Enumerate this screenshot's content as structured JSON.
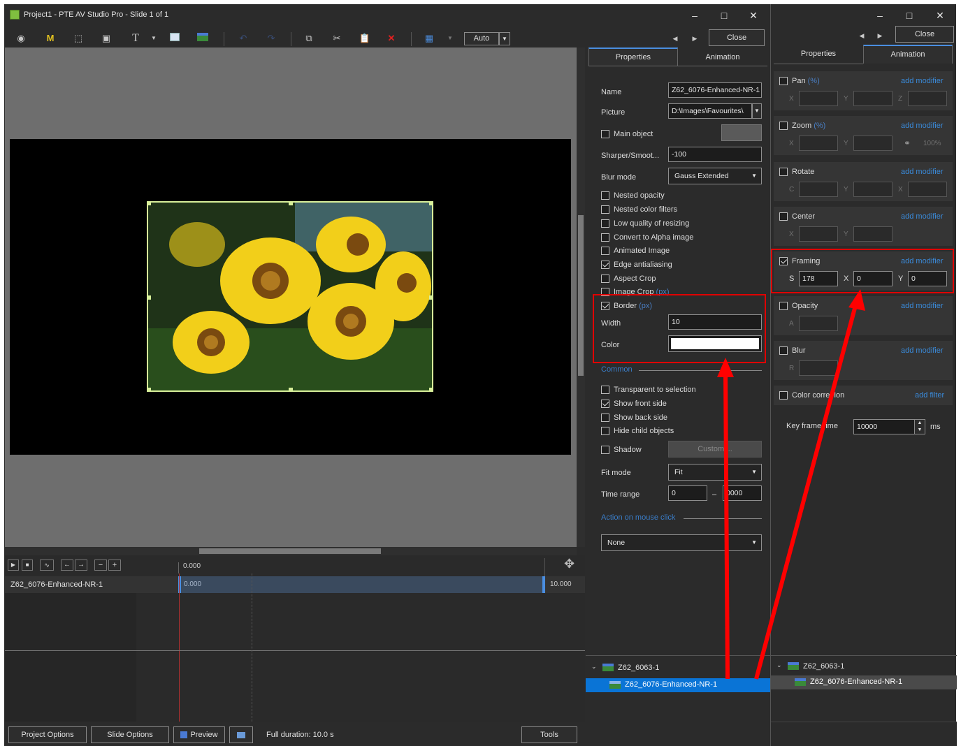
{
  "window": {
    "title": "Project1 - PTE AV Studio Pro - Slide 1 of 1",
    "minimize": "–",
    "maximize": "□",
    "close": "✕"
  },
  "toolbar": {
    "auto_label": "Auto",
    "close_label": "Close"
  },
  "properties_tabs": [
    "Properties",
    "Animation"
  ],
  "properties": {
    "name_label": "Name",
    "name_value": "Z62_6076-Enhanced-NR-1",
    "picture_label": "Picture",
    "picture_value": "D:\\Images\\Favourites\\",
    "main_object_label": "Main object",
    "sharper_label": "Sharper/Smoot...",
    "sharper_value": "-100",
    "blur_mode_label": "Blur mode",
    "blur_mode_value": "Gauss Extended",
    "checkboxes": [
      {
        "label": "Nested opacity",
        "checked": false
      },
      {
        "label": "Nested color filters",
        "checked": false
      },
      {
        "label": "Low quality of resizing",
        "checked": false
      },
      {
        "label": "Convert to Alpha image",
        "checked": false
      },
      {
        "label": "Animated Image",
        "checked": false
      },
      {
        "label": "Edge antialiasing",
        "checked": true
      },
      {
        "label": "Aspect Crop",
        "checked": false
      },
      {
        "label": "Image Crop",
        "unit": "(px)",
        "checked": false
      },
      {
        "label": "Border",
        "unit": "(px)",
        "checked": true
      }
    ],
    "width_label": "Width",
    "width_value": "10",
    "color_label": "Color",
    "border_color": "#ffffff",
    "common_label": "Common",
    "common_checkboxes": [
      {
        "label": "Transparent to selection",
        "checked": false
      },
      {
        "label": "Show front side",
        "checked": true
      },
      {
        "label": "Show back side",
        "checked": false
      },
      {
        "label": "Hide child objects",
        "checked": false
      }
    ],
    "shadow_label": "Shadow",
    "customize_label": "Customi...",
    "fit_mode_label": "Fit mode",
    "fit_mode_value": "Fit",
    "time_range_label": "Time range",
    "time_range_from": "0",
    "time_range_dash": "–",
    "time_range_to": "0000",
    "action_label": "Action on mouse click",
    "action_value": "None"
  },
  "objects_tree": {
    "parent": "Z62_6063-1",
    "child": "Z62_6076-Enhanced-NR-1"
  },
  "animation": {
    "add_modifier": "add modifier",
    "add_filter": "add filter",
    "pan": {
      "label": "Pan",
      "unit": "(%)",
      "x": "X",
      "y": "Y",
      "z": "Z"
    },
    "zoom": {
      "label": "Zoom",
      "unit": "(%)",
      "x": "X",
      "y": "Y",
      "pct": "100%"
    },
    "rotate": {
      "label": "Rotate",
      "c": "C",
      "y": "Y",
      "x": "X"
    },
    "center": {
      "label": "Center",
      "x": "X",
      "y": "Y"
    },
    "framing": {
      "label": "Framing",
      "s": "S",
      "s_value": "178",
      "x": "X",
      "x_value": "0",
      "y": "Y",
      "y_value": "0"
    },
    "opacity": {
      "label": "Opacity",
      "a": "A"
    },
    "blur": {
      "label": "Blur",
      "r": "R"
    },
    "color_correction": {
      "label": "Color corre  ion"
    },
    "key_frame_label": "Key frame  ime",
    "key_frame_value": "10000",
    "key_frame_unit": "ms"
  },
  "timeline": {
    "time_start": "0.000",
    "track_name": "Z62_6076-Enhanced-NR-1",
    "clip_start": "0.000",
    "clip_end": "10.000"
  },
  "statusbar": {
    "project_options": "Project Options",
    "slide_options": "Slide Options",
    "preview": "Preview",
    "full_duration": "Full duration: 10.0 s",
    "tools": "Tools"
  }
}
